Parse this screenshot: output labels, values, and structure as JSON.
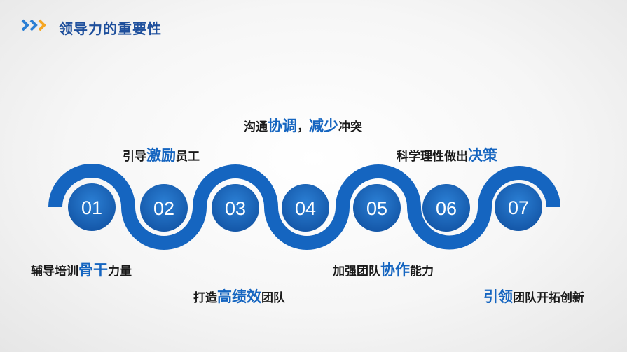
{
  "header": {
    "title": "领导力的重要性"
  },
  "colors": {
    "accent_blue": "#1565c0",
    "arrow_orange": "#f5a623",
    "arrow_blue": "#2b7fd4"
  },
  "steps": [
    {
      "number": "01",
      "pre": "辅导培训",
      "hl": "骨干",
      "post": "力量"
    },
    {
      "number": "02",
      "pre": "引导",
      "hl": "激励",
      "post": "员工"
    },
    {
      "number": "03",
      "pre": "打造",
      "hl": "高绩效",
      "post": "团队"
    },
    {
      "number": "04",
      "pre": "沟通",
      "hl": "协调",
      "mid": "，",
      "hl2": "减少",
      "post": "冲突"
    },
    {
      "number": "05",
      "pre": "加强团队",
      "hl": "协作",
      "post": "能力"
    },
    {
      "number": "06",
      "pre": "科学理性做出",
      "hl": "决策",
      "post": ""
    },
    {
      "number": "07",
      "pre": "",
      "hl": "引领",
      "post": "团队开拓创新"
    }
  ]
}
